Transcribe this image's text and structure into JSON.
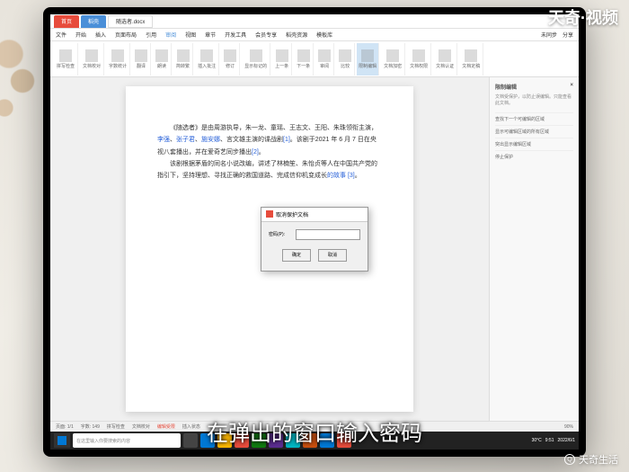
{
  "watermarks": {
    "top_right": "天奇·视频",
    "bottom_right": "天奇生活"
  },
  "subtitle": "在弹出的窗口输入密码",
  "titlebar": {
    "tab1": "首页",
    "tab2": "稻壳",
    "tab3": "随选者.docx"
  },
  "menu": {
    "items": [
      "文件",
      "开始",
      "插入",
      "页面布局",
      "引用",
      "审阅",
      "视图",
      "章节",
      "开发工具",
      "会员专享",
      "稻壳资源",
      "模板库"
    ],
    "active": "审阅",
    "right1": "未同步",
    "right2": "分享"
  },
  "toolbar": {
    "labels": [
      "拼写检查",
      "文档校对",
      "字数统计",
      "翻译",
      "朗读",
      "简转繁",
      "插入批注",
      "修订",
      "显示标记的",
      "上一条",
      "下一条",
      "审阅",
      "比较",
      "限制编辑",
      "文档加密",
      "文档权限",
      "文档认证",
      "文档定稿"
    ]
  },
  "document": {
    "p1_a": "《随选者》是由周游执导，朱一龙、童瑶、王志文、王阳、朱珠领衔主演，",
    "p1_link1": "李强",
    "p1_b": "、",
    "p1_link2": "张子君",
    "p1_c": "、",
    "p1_link3": "施安娜",
    "p1_d": "、言文雄主演的谍战剧",
    "p1_link4": "[1]",
    "p1_e": "。该剧于2021 年 6 月 7 日在央视八套播出，并在爱奇艺同步播出",
    "p1_link5": "[2]",
    "p1_f": "。",
    "p2_a": "该剧根据茅盾的同名小说改编，讲述了林楠笙、朱怡贞等人在中国共产党的指引下，坚持理想、寻找正确的救国道路、完成信仰机变成长",
    "p2_link": "的故事 [3]",
    "p2_b": "。"
  },
  "sidebar": {
    "title": "限制编辑",
    "close": "×",
    "desc": "文档受保护，以防止误编辑。只能查看此文档。",
    "items": [
      "查找下一个可编辑的区域",
      "显示可编辑区域的所有区域",
      "突出显示编辑区域"
    ],
    "btn": "停止保护"
  },
  "dialog": {
    "title": "取消保护文档",
    "label": "密码(P):",
    "value": "",
    "ok": "确定",
    "cancel": "取消"
  },
  "statusbar": {
    "page": "页面: 1/1",
    "words": "字数: 149",
    "spell": "拼写检查",
    "doc": "文档校对",
    "lock": "编辑受限",
    "insert": "插入状态",
    "zoom": "90%"
  },
  "taskbar": {
    "search_placeholder": "在这里输入你要搜索的内容",
    "weather": "30°C",
    "time": "9:51",
    "date": "2022/6/1"
  }
}
